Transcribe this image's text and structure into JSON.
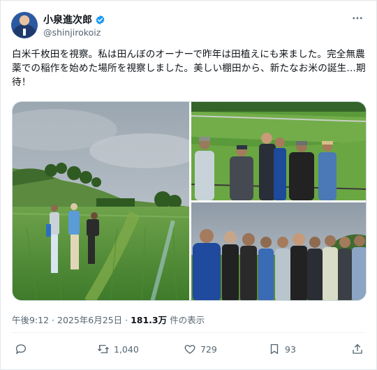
{
  "author": {
    "display_name": "小泉進次郎",
    "handle": "@shinjirokoiz",
    "verified_color": "#1d9bf0"
  },
  "tweet": {
    "text": "白米千枚田を視察。私は田んぼのオーナーで昨年は田植えにも来ました。完全無農薬での稲作を始めた場所を視察しました。美しい棚田から、新たなお米の誕生…期待！"
  },
  "media": {
    "count": 3,
    "images": [
      "rice-terrace-field-photo",
      "group-on-hillside-photo",
      "group-standing-photo"
    ]
  },
  "meta": {
    "time": "午後9:12",
    "separator": " · ",
    "date": "2025年6月25日",
    "views_count": "181.3万",
    "views_label": " 件の表示"
  },
  "actions": {
    "reply_icon": "reply-icon",
    "retweets": "1,040",
    "likes": "729",
    "bookmarks": "93",
    "share_icon": "share-icon"
  },
  "colors": {
    "text": "#0f1419",
    "secondary": "#536471",
    "accent": "#1d9bf0"
  }
}
